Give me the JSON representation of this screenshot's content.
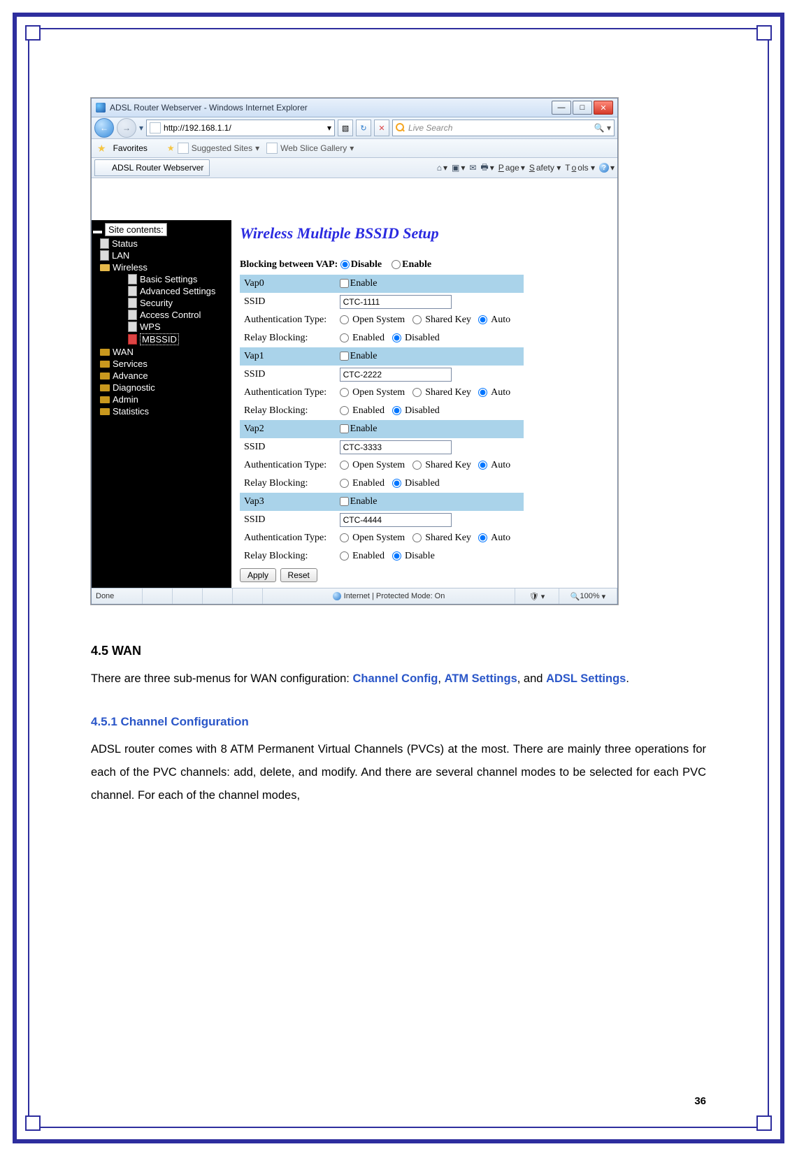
{
  "window": {
    "title": "ADSL Router Webserver - Windows Internet Explorer",
    "url": "http://192.168.1.1/",
    "search_placeholder": "Live Search",
    "favorites_label": "Favorites",
    "suggested": "Suggested Sites",
    "webslice": "Web Slice Gallery",
    "tab": "ADSL Router Webserver",
    "menu_page": "Page",
    "menu_safety": "Safety",
    "menu_tools": "Tools",
    "status_done": "Done",
    "status_zone": "Internet | Protected Mode: On",
    "zoom": "100%"
  },
  "sidebar": {
    "header": "Site contents:",
    "items": [
      {
        "label": "Status",
        "icon": "page"
      },
      {
        "label": "LAN",
        "icon": "page"
      },
      {
        "label": "Wireless",
        "icon": "folder-open",
        "children": [
          {
            "label": "Basic Settings",
            "icon": "page"
          },
          {
            "label": "Advanced Settings",
            "icon": "page"
          },
          {
            "label": "Security",
            "icon": "page"
          },
          {
            "label": "Access Control",
            "icon": "page"
          },
          {
            "label": "WPS",
            "icon": "page"
          },
          {
            "label": "MBSSID",
            "icon": "page-red",
            "selected": true
          }
        ]
      },
      {
        "label": "WAN",
        "icon": "folder"
      },
      {
        "label": "Services",
        "icon": "folder"
      },
      {
        "label": "Advance",
        "icon": "folder"
      },
      {
        "label": "Diagnostic",
        "icon": "folder"
      },
      {
        "label": "Admin",
        "icon": "folder"
      },
      {
        "label": "Statistics",
        "icon": "folder"
      }
    ]
  },
  "main": {
    "heading": "Wireless Multiple BSSID Setup",
    "blocking_label": "Blocking between VAP:",
    "disable": "Disable",
    "enable": "Enable",
    "open_system": "Open System",
    "shared_key": "Shared Key",
    "auto": "Auto",
    "enabled": "Enabled",
    "disabled": "Disabled",
    "ssid_label": "SSID",
    "auth_label": "Authentication Type:",
    "relay_label": "Relay Blocking:",
    "apply": "Apply",
    "reset": "Reset",
    "vaps": [
      {
        "name": "Vap0",
        "ssid": "CTC-1111",
        "relay_disabled_label": "Disabled"
      },
      {
        "name": "Vap1",
        "ssid": "CTC-2222",
        "relay_disabled_label": "Disabled"
      },
      {
        "name": "Vap2",
        "ssid": "CTC-3333",
        "relay_disabled_label": "Disabled"
      },
      {
        "name": "Vap3",
        "ssid": "CTC-4444",
        "relay_disabled_label": "Disable"
      }
    ]
  },
  "doc": {
    "h2": "4.5 WAN",
    "p1a": "There are three sub-menus for WAN configuration: ",
    "l1": "Channel Config",
    "sep": ", ",
    "l2": "ATM Settings",
    "p1b": ", and ",
    "l3": "ADSL Settings",
    "p1c": ".",
    "h3": "4.5.1 Channel Configuration",
    "p2": "ADSL router comes with 8 ATM Permanent Virtual Channels (PVCs) at the most. There are mainly three operations for each of the PVC channels: add, delete, and modify. And there are several channel modes to be selected for each PVC channel. For each of the channel modes,"
  },
  "pagenum": "36"
}
